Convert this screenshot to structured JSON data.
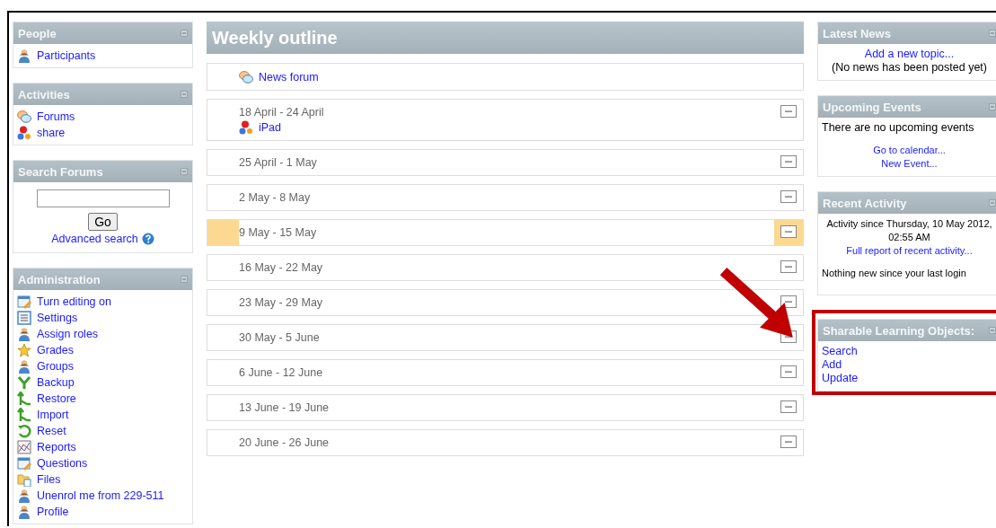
{
  "left_blocks": [
    {
      "kind": "links",
      "title": "People",
      "items": [
        {
          "label": "Participants",
          "kind": "person"
        }
      ]
    },
    {
      "kind": "links",
      "title": "Activities",
      "items": [
        {
          "label": "Forums",
          "kind": "forum"
        },
        {
          "label": "share",
          "kind": "share"
        }
      ]
    },
    {
      "kind": "search",
      "title": "Search Forums",
      "button": "Go",
      "link": "Advanced search"
    },
    {
      "kind": "links",
      "title": "Administration",
      "items": [
        {
          "label": "Turn editing on",
          "kind": "edit"
        },
        {
          "label": "Settings",
          "kind": "list"
        },
        {
          "label": "Assign roles",
          "kind": "person"
        },
        {
          "label": "Grades",
          "kind": "star"
        },
        {
          "label": "Groups",
          "kind": "person"
        },
        {
          "label": "Backup",
          "kind": "down"
        },
        {
          "label": "Restore",
          "kind": "up"
        },
        {
          "label": "Import",
          "kind": "up"
        },
        {
          "label": "Reset",
          "kind": "reset"
        },
        {
          "label": "Reports",
          "kind": "chart"
        },
        {
          "label": "Questions",
          "kind": "edit"
        },
        {
          "label": "Files",
          "kind": "folder"
        },
        {
          "label": "Unenrol me from 229-511",
          "kind": "person"
        },
        {
          "label": "Profile",
          "kind": "person"
        }
      ]
    }
  ],
  "outline": {
    "title": "Weekly outline",
    "sections": [
      {
        "current": false,
        "collapsible": false,
        "items": [
          {
            "label": "News forum",
            "kind": "forum"
          }
        ]
      },
      {
        "title": "18 April - 24 April",
        "current": false,
        "collapsible": true,
        "items": [
          {
            "label": "iPad",
            "kind": "share"
          }
        ]
      },
      {
        "title": "25 April - 1 May",
        "current": false,
        "collapsible": true
      },
      {
        "title": "2 May - 8 May",
        "current": false,
        "collapsible": true
      },
      {
        "title": "9 May - 15 May",
        "current": true,
        "collapsible": true
      },
      {
        "title": "16 May - 22 May",
        "current": false,
        "collapsible": true
      },
      {
        "title": "23 May - 29 May",
        "current": false,
        "collapsible": true
      },
      {
        "title": "30 May - 5 June",
        "current": false,
        "collapsible": true
      },
      {
        "title": "6 June - 12 June",
        "current": false,
        "collapsible": true
      },
      {
        "title": "13 June - 19 June",
        "current": false,
        "collapsible": true
      },
      {
        "title": "20 June - 26 June",
        "current": false,
        "collapsible": true
      }
    ]
  },
  "right_blocks": [
    {
      "title": "Latest News",
      "highlighted": false,
      "lines": [
        {
          "kind": "centerlink",
          "text": "Add a new topic..."
        },
        {
          "kind": "centertext",
          "text": "(No news has been posted yet)"
        }
      ]
    },
    {
      "title": "Upcoming Events",
      "highlighted": false,
      "lines": [
        {
          "kind": "text",
          "text": "There are no upcoming events"
        },
        {
          "kind": "gap"
        },
        {
          "kind": "smalllink",
          "text": "Go to calendar..."
        },
        {
          "kind": "smalllink",
          "text": "New Event..."
        }
      ]
    },
    {
      "title": "Recent Activity",
      "highlighted": false,
      "lines": [
        {
          "kind": "note",
          "text": "Activity since Thursday, 10 May 2012, 02:55 AM"
        },
        {
          "kind": "smalllink",
          "text": "Full report of recent activity..."
        },
        {
          "kind": "gap"
        },
        {
          "kind": "smalltext",
          "text": "Nothing new since your last login"
        },
        {
          "kind": "gap"
        }
      ]
    },
    {
      "title": "Sharable Learning Objects:",
      "highlighted": true,
      "lines": [
        {
          "kind": "link",
          "text": "Search"
        },
        {
          "kind": "link",
          "text": "Add"
        },
        {
          "kind": "link",
          "text": "Update"
        }
      ]
    }
  ]
}
